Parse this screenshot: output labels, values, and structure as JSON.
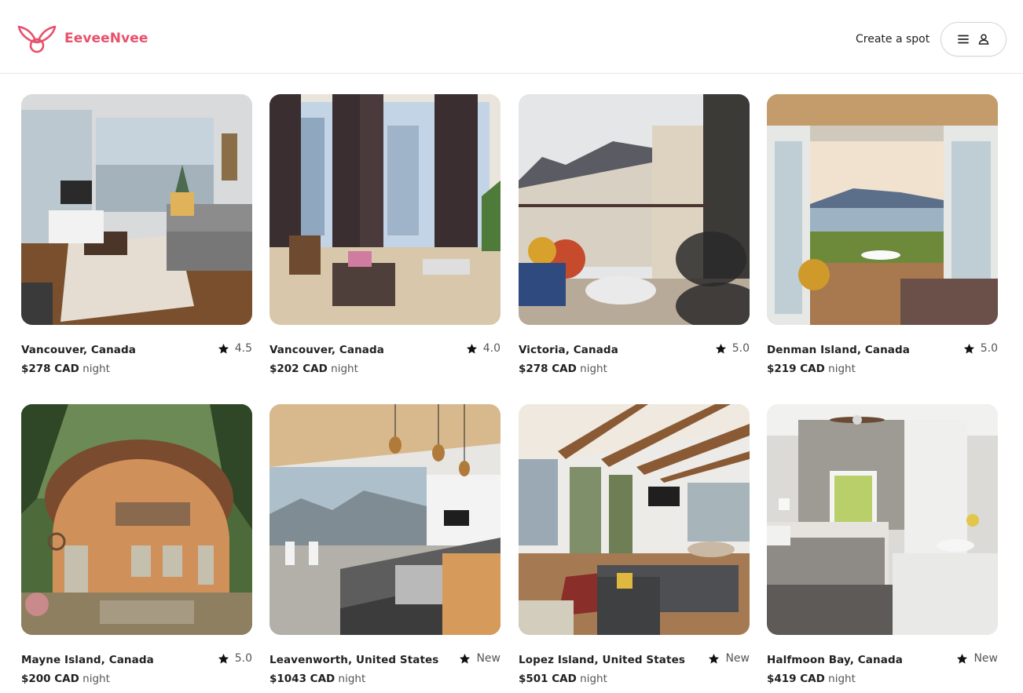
{
  "brand": {
    "name": "EeveeNvee",
    "accent": "#e8506b"
  },
  "header": {
    "create_spot_label": "Create a spot",
    "menu_icon": "hamburger-icon",
    "user_icon": "user-icon"
  },
  "listings": [
    {
      "location": "Vancouver, Canada",
      "rating": "4.5",
      "price": "$278 CAD",
      "unit": "night",
      "photo": "living-room-lake-view"
    },
    {
      "location": "Vancouver, Canada",
      "rating": "4.0",
      "price": "$202 CAD",
      "unit": "night",
      "photo": "condo-tall-windows"
    },
    {
      "location": "Victoria, Canada",
      "rating": "5.0",
      "price": "$278 CAD",
      "unit": "night",
      "photo": "balcony-chairs"
    },
    {
      "location": "Denman Island, Canada",
      "rating": "5.0",
      "price": "$219 CAD",
      "unit": "night",
      "photo": "deck-ocean-view"
    },
    {
      "location": "Mayne Island, Canada",
      "rating": "5.0",
      "price": "$200 CAD",
      "unit": "night",
      "photo": "cob-cottage"
    },
    {
      "location": "Leavenworth, United States",
      "rating": "New",
      "price": "$1043 CAD",
      "unit": "night",
      "photo": "modern-kitchen"
    },
    {
      "location": "Lopez Island, United States",
      "rating": "New",
      "price": "$501 CAD",
      "unit": "night",
      "photo": "beamed-living-room"
    },
    {
      "location": "Halfmoon Bay, Canada",
      "rating": "New",
      "price": "$419 CAD",
      "unit": "night",
      "photo": "bedroom-window"
    }
  ]
}
